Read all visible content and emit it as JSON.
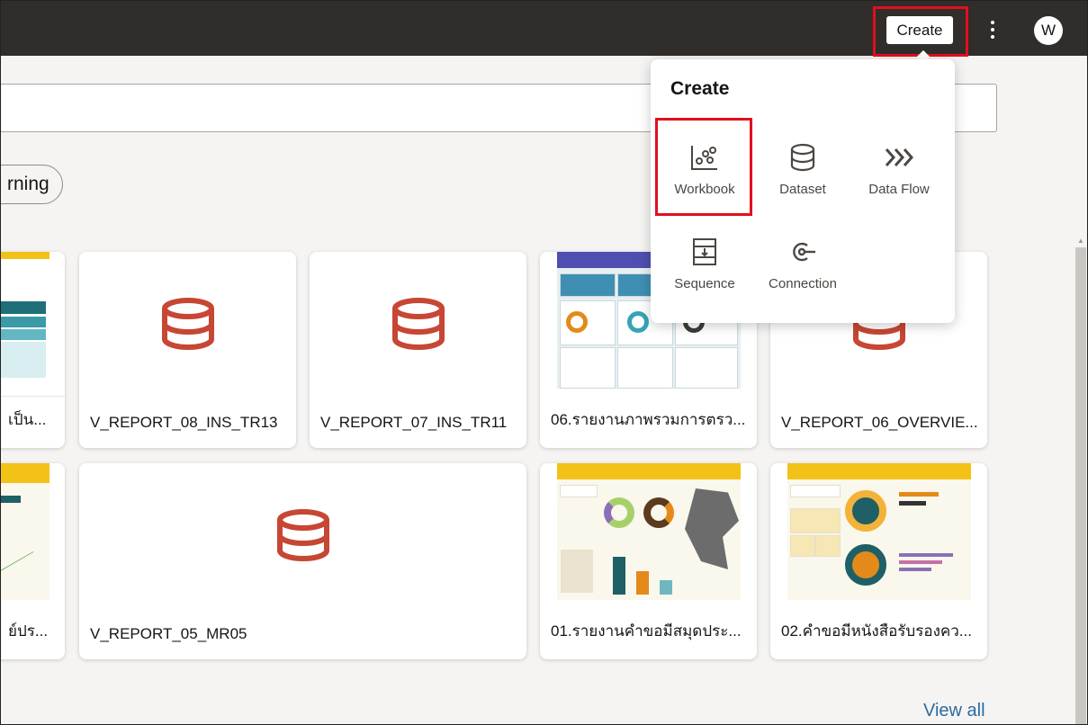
{
  "topbar": {
    "create_label": "Create",
    "avatar_initial": "W"
  },
  "filters": {
    "chip_label": "rning"
  },
  "cards_row1": [
    {
      "label": "เป็น..."
    },
    {
      "label": "V_REPORT_08_INS_TR13"
    },
    {
      "label": "V_REPORT_07_INS_TR11"
    },
    {
      "label": "06.รายงานภาพรวมการตรว..."
    },
    {
      "label": "V_REPORT_06_OVERVIE..."
    }
  ],
  "cards_row2": [
    {
      "label": "ย์ปร..."
    },
    {
      "label": "V_REPORT_05_MR05"
    },
    {
      "label": "01.รายงานคำขอมีสมุดประ..."
    },
    {
      "label": "02.คำขอมีหนังสือรับรองคว..."
    }
  ],
  "create_menu": {
    "title": "Create",
    "items": [
      {
        "label": "Workbook",
        "icon": "workbook-icon"
      },
      {
        "label": "Dataset",
        "icon": "dataset-icon"
      },
      {
        "label": "Data Flow",
        "icon": "data-flow-icon"
      },
      {
        "label": "Sequence",
        "icon": "sequence-icon"
      },
      {
        "label": "Connection",
        "icon": "connection-icon"
      }
    ]
  },
  "view_all_label": "View all",
  "colors": {
    "topbar": "#312d2a",
    "dataset_red": "#c74634",
    "highlight": "#e0101e",
    "link": "#2b6ba3"
  }
}
